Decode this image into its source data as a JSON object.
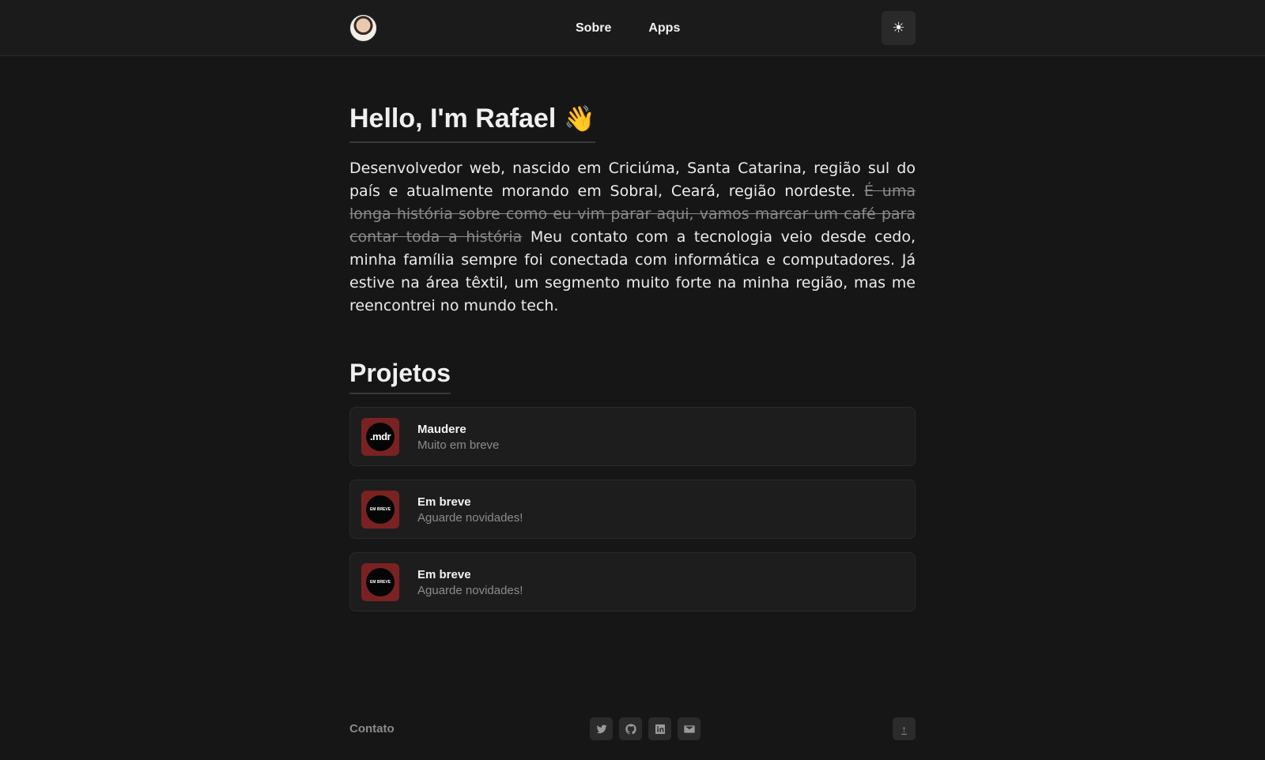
{
  "header": {
    "nav": [
      {
        "label": "Sobre"
      },
      {
        "label": "Apps"
      }
    ],
    "theme_toggle_icon": "sun-icon",
    "theme_toggle_glyph": "☀"
  },
  "hero": {
    "title": "Hello, I'm Rafael",
    "emoji": "👋",
    "bio_part1": "Desenvolvedor web, nascido em Criciúma, Santa Catarina, região sul do país e atualmente morando em Sobral, Ceará, região nordeste.",
    "bio_strike": "É uma longa história sobre como eu vim parar aqui, vamos marcar um café para contar toda a história",
    "bio_part2": "Meu contato com a tecnologia veio desde cedo, minha família sempre foi conectada com informática e computadores. Já estive na área têxtil, um segmento muito forte na minha região, mas me reencontrei no mundo tech."
  },
  "projects": {
    "title": "Projetos",
    "items": [
      {
        "name": "Maudere",
        "description": "Muito em breve",
        "logo_text": ".mdr"
      },
      {
        "name": "Em breve",
        "description": "Aguarde novidades!",
        "logo_text": "EM BREVE"
      },
      {
        "name": "Em breve",
        "description": "Aguarde novidades!",
        "logo_text": "EM BREVE"
      }
    ]
  },
  "footer": {
    "label": "Contato",
    "socials": [
      "twitter-icon",
      "github-icon",
      "linkedin-icon",
      "mail-icon"
    ],
    "top_icon": "arrow-up-icon",
    "top_glyph": "↑"
  },
  "colors": {
    "background": "#161616",
    "header": "#1b1b1b",
    "card": "#1d1d1d",
    "project_icon_bg": "#7a2222"
  }
}
